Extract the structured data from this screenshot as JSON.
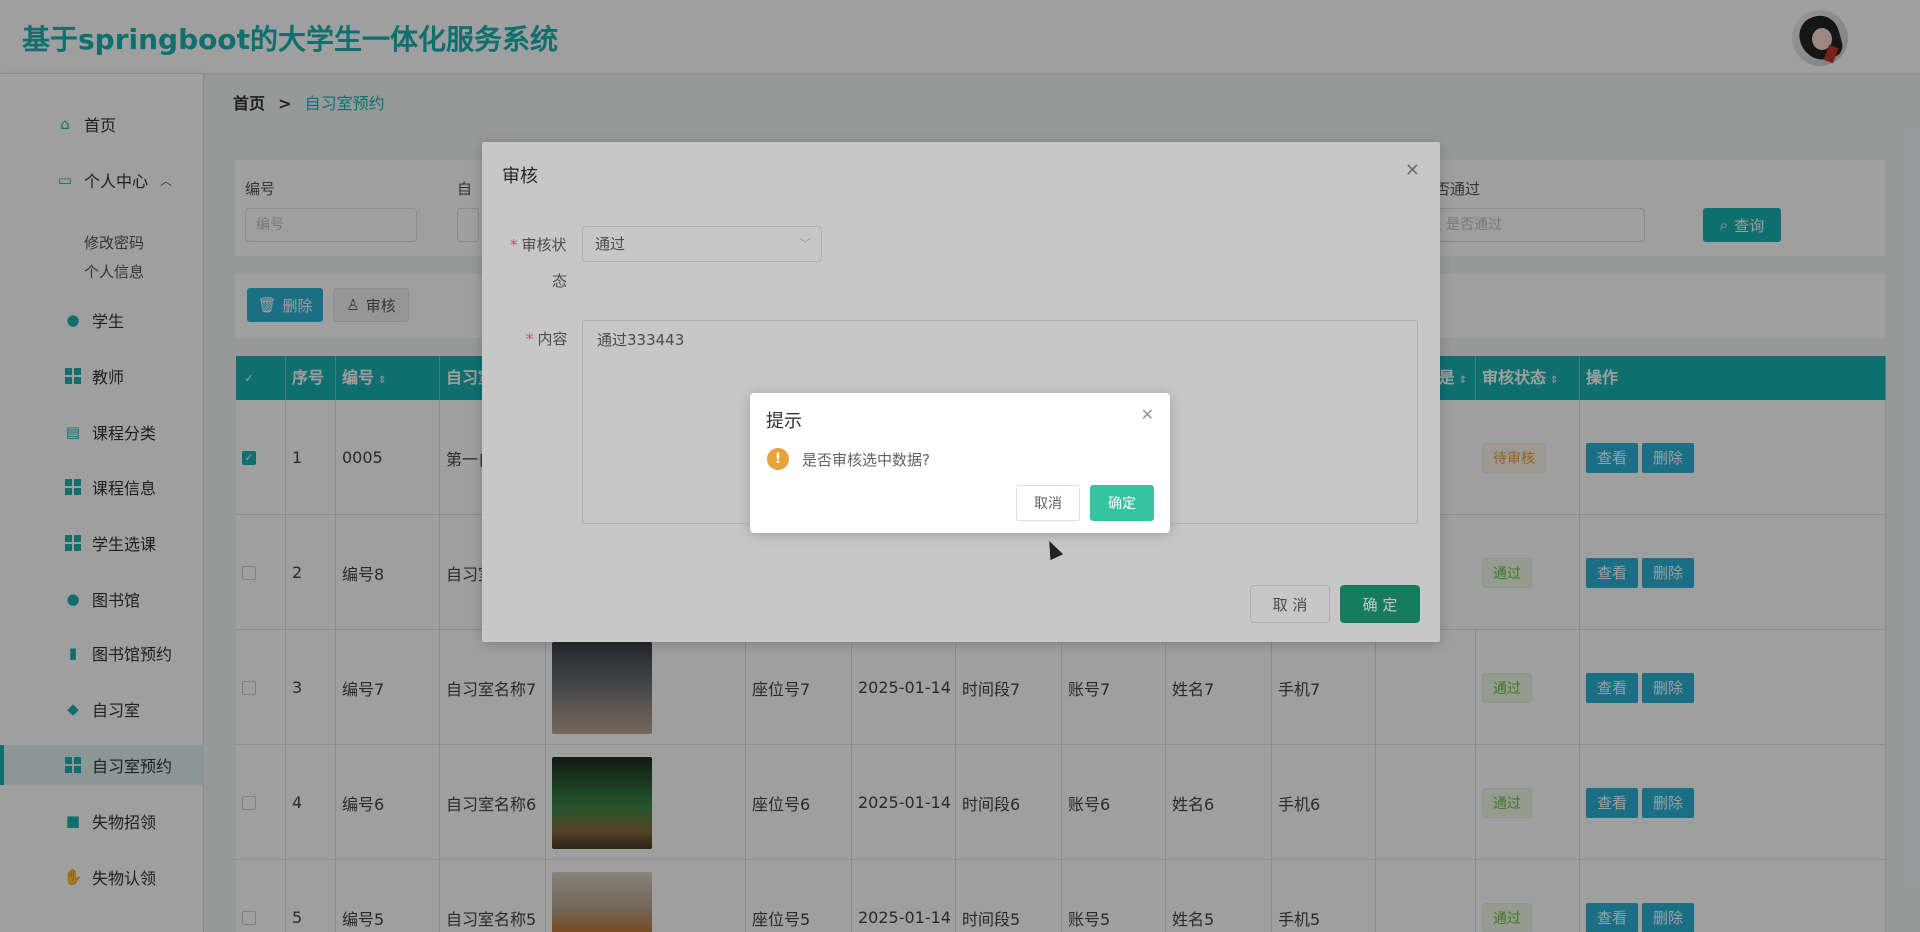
{
  "app": {
    "title": "基于springboot的大学生一体化服务系统"
  },
  "sidebar": {
    "home": "首页",
    "personal": "个人中心",
    "change_password": "修改密码",
    "profile": "个人信息",
    "items": [
      {
        "label": "学生",
        "icon": "user-icon"
      },
      {
        "label": "教师",
        "icon": "grid-icon"
      },
      {
        "label": "课程分类",
        "icon": "chart-icon"
      },
      {
        "label": "课程信息",
        "icon": "grid-icon"
      },
      {
        "label": "学生选课",
        "icon": "grid-icon"
      },
      {
        "label": "图书馆",
        "icon": "user-icon"
      },
      {
        "label": "图书馆预约",
        "icon": "book-icon"
      },
      {
        "label": "自习室",
        "icon": "pin-icon"
      },
      {
        "label": "自习室预约",
        "icon": "grid-icon"
      },
      {
        "label": "失物招领",
        "icon": "briefcase-icon"
      },
      {
        "label": "失物认领",
        "icon": "hand-icon"
      }
    ]
  },
  "breadcrumb": {
    "home": "首页",
    "separator": ">",
    "current": "自习室预约"
  },
  "search": {
    "fields": [
      {
        "label": "编号",
        "placeholder": "编号"
      },
      {
        "label": "自",
        "placeholder": ""
      },
      {
        "label": "否通过",
        "placeholder": "是否通过"
      }
    ],
    "query_button": "查询"
  },
  "actions": {
    "delete": "删除",
    "audit": "审核"
  },
  "table": {
    "headers": [
      "序号",
      "编号",
      "自习室",
      "审核状态",
      "操作"
    ],
    "hidden_header_fragment": "是",
    "rows": [
      {
        "index": "1",
        "code": "0005",
        "room": "第一自",
        "seat": "",
        "date": "",
        "slot": "",
        "account": "",
        "name": "",
        "phone": "",
        "status": "待审核",
        "checked": true
      },
      {
        "index": "2",
        "code": "编号8",
        "room": "自习室",
        "seat": "",
        "date": "",
        "slot": "",
        "account": "",
        "name": "",
        "phone": "",
        "status": "通过",
        "checked": false
      },
      {
        "index": "3",
        "code": "编号7",
        "room": "自习室名称7",
        "seat": "座位号7",
        "date": "2025-01-14",
        "slot": "时间段7",
        "account": "账号7",
        "name": "姓名7",
        "phone": "手机7",
        "status": "通过",
        "checked": false
      },
      {
        "index": "4",
        "code": "编号6",
        "room": "自习室名称6",
        "seat": "座位号6",
        "date": "2025-01-14",
        "slot": "时间段6",
        "account": "账号6",
        "name": "姓名6",
        "phone": "手机6",
        "status": "通过",
        "checked": false
      },
      {
        "index": "5",
        "code": "编号5",
        "room": "自习室名称5",
        "seat": "座位号5",
        "date": "2025-01-14",
        "slot": "时间段5",
        "account": "账号5",
        "name": "姓名5",
        "phone": "手机5",
        "status": "通过",
        "checked": false
      }
    ],
    "view_label": "查看",
    "delete_label": "删除"
  },
  "audit_dialog": {
    "title": "审核",
    "status_label_1": "审核状",
    "status_label_2": "态",
    "status_value": "通过",
    "content_label": "内容",
    "content_value": "通过333443",
    "cancel": "取 消",
    "confirm": "确 定"
  },
  "message_box": {
    "title": "提示",
    "text": "是否审核选中数据?",
    "cancel": "取消",
    "confirm": "确定"
  }
}
